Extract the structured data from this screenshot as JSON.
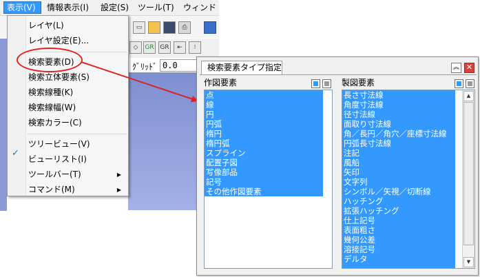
{
  "menubar": {
    "items": [
      "表示(V)",
      "情報表示(I)",
      "設定(S)",
      "ツール(T)",
      "ウィンド"
    ]
  },
  "toolbar": {
    "grid_label": "ｸﾞﾘｯﾄﾞ",
    "grid_value": "0.0",
    "icons": [
      "new-file-icon",
      "open-folder-icon",
      "save-icon",
      "print-icon"
    ],
    "gr_labels": [
      "GR",
      "GR"
    ]
  },
  "menu": {
    "items": [
      {
        "label": "レイヤ(L)"
      },
      {
        "label": "レイヤ設定(E)..."
      },
      {
        "label": "検索要素(D)"
      },
      {
        "label": "検索立体要素(S)"
      },
      {
        "label": "検索線種(K)"
      },
      {
        "label": "検索線幅(W)"
      },
      {
        "label": "検索カラー(C)"
      },
      {
        "label": "ツリービュー(V)",
        "checked": true
      },
      {
        "label": "ビューリスト(I)"
      },
      {
        "label": "ツールバー(T)",
        "submenu": true
      },
      {
        "label": "コマンド(M)",
        "submenu": true
      }
    ],
    "check_glyph": "✓",
    "submenu_glyph": "▶"
  },
  "annotation": {
    "color": "#e02020"
  },
  "dialog": {
    "tab_title": "検索要素タイプ指定",
    "collapse_glyph": "︽",
    "close_glyph": "✕",
    "left": {
      "label": "作図要素",
      "items": [
        "点",
        "線",
        "円",
        "円弧",
        "楕円",
        "楕円弧",
        "スプライン",
        "配置子図",
        "写像部品",
        "記号",
        "その他作図要素"
      ]
    },
    "right": {
      "label": "製図要素",
      "items": [
        "長さ寸法線",
        "角度寸法線",
        "径寸法線",
        "面取り寸法線",
        "角／長円／角穴／座標寸法線",
        "円弧長寸法線",
        "注記",
        "風船",
        "矢印",
        "文字列",
        "シンボル／矢視／切断線",
        "ハッチング",
        "拡張ハッチング",
        "仕上記号",
        "表面粗さ",
        "幾何公差",
        "溶接記号",
        "デルタ"
      ]
    },
    "selection_color": "#3399ff"
  }
}
